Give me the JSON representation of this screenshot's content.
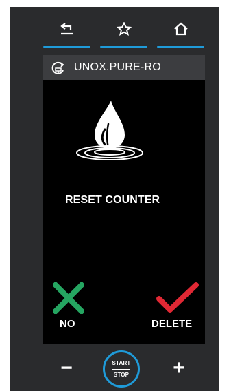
{
  "nav": {
    "items": [
      {
        "icon": "back-icon"
      },
      {
        "icon": "star-icon"
      },
      {
        "icon": "home-icon"
      }
    ],
    "accent": "#1f9bd9"
  },
  "screen": {
    "title": "UNOX.PURE-RO",
    "title_icon": "filter-refresh-icon",
    "main_icon": "water-drop-icon",
    "message": "RESET COUNTER",
    "no_label": "NO",
    "no_color": "#25a561",
    "delete_label": "DELETE",
    "delete_color": "#e02834"
  },
  "controls": {
    "minus": "−",
    "plus": "+",
    "start": "START",
    "stop": "STOP"
  }
}
